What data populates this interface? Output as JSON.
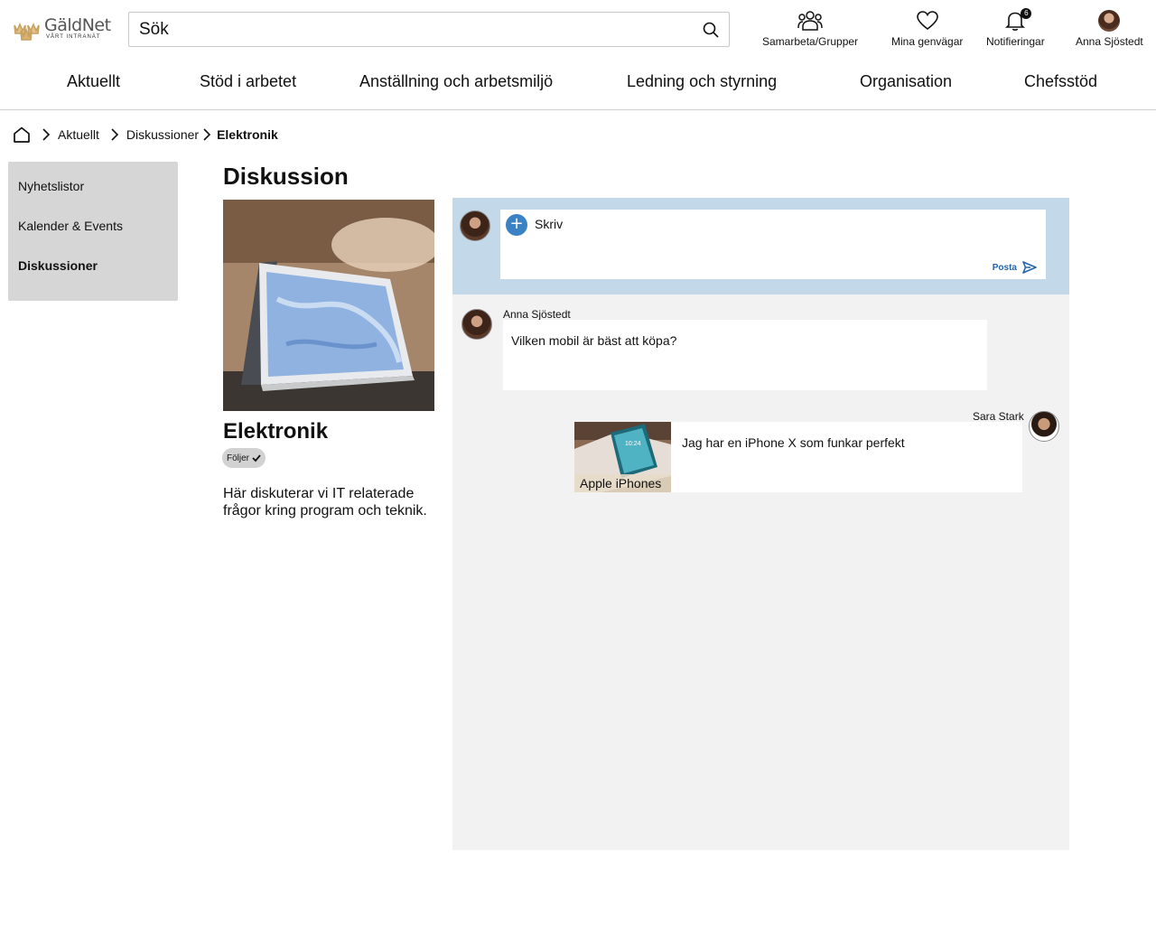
{
  "header": {
    "logo": {
      "name": "GäldNet",
      "subtitle": "VÅRT INTRANÄT"
    },
    "search": {
      "placeholder": "Sök"
    },
    "actions": [
      {
        "label": "Samarbeta/Grupper",
        "icon": "people-group-icon"
      },
      {
        "label": "Mina genvägar",
        "icon": "heart-icon"
      },
      {
        "label": "Notifieringar",
        "icon": "bell-icon",
        "badge": "6"
      },
      {
        "label": "Anna Sjöstedt",
        "icon": "user-avatar"
      }
    ]
  },
  "nav": {
    "items": [
      "Aktuellt",
      "Stöd i arbetet",
      "Anställning och arbetsmiljö",
      "Ledning och styrning",
      "Organisation",
      "Chefsstöd"
    ]
  },
  "breadcrumb": {
    "home_icon": "home-icon",
    "items": [
      "Aktuellt",
      "Diskussioner",
      "Elektronik"
    ]
  },
  "sidebar": {
    "items": [
      {
        "label": "Nyhetslistor",
        "active": false
      },
      {
        "label": "Kalender & Events",
        "active": false
      },
      {
        "label": "Diskussioner",
        "active": true
      }
    ]
  },
  "page": {
    "title": "Diskussion"
  },
  "group": {
    "name": "Elektronik",
    "follow_label": "Följer",
    "description": "Här diskuterar vi IT relaterade frågor kring program och teknik."
  },
  "composer": {
    "placeholder": "Skriv",
    "post_label": "Posta"
  },
  "posts": [
    {
      "author": "Anna Sjöstedt",
      "text": "Vilken mobil är bäst att köpa?"
    },
    {
      "author": "Sara Stark",
      "text": "Jag har en iPhone X som funkar perfekt",
      "attachment_label": "Apple iPhones"
    }
  ],
  "colors": {
    "composer_bg": "#c3d9e9",
    "feed_bg": "#f2f2f2",
    "sidebar_bg": "#d6d6d6",
    "accent": "#3b82c4",
    "post_link": "#2465a6"
  }
}
